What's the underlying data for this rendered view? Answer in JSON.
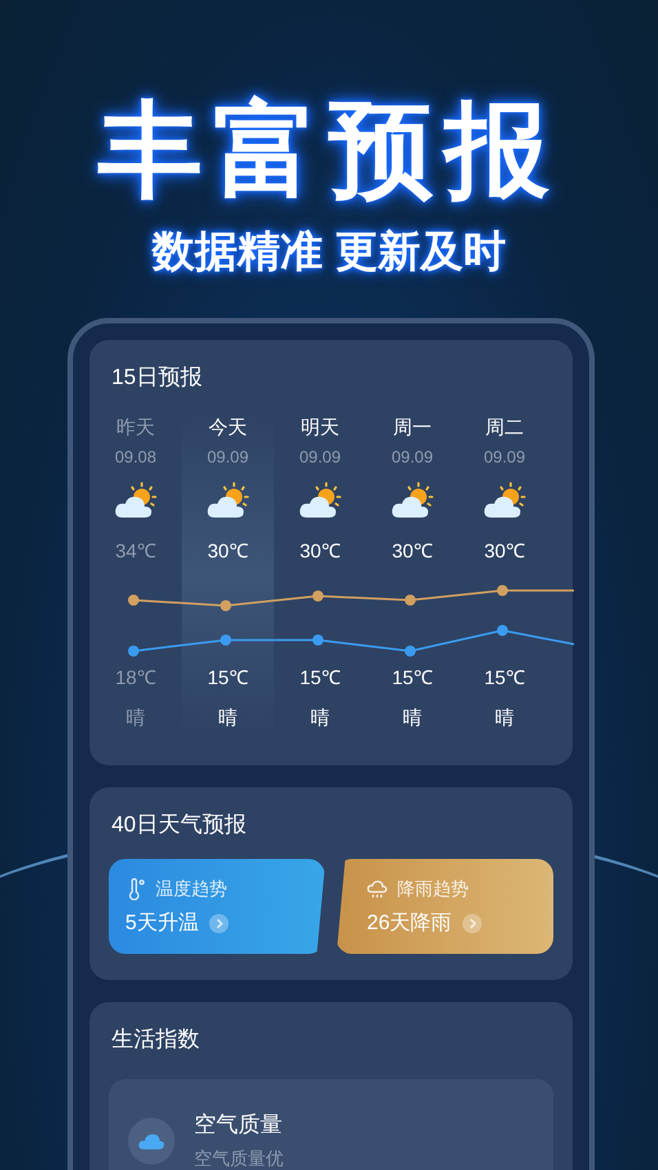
{
  "headline": "丰富预报",
  "subheadline": "数据精准 更新及时",
  "forecast_15": {
    "title": "15日预报",
    "days": [
      {
        "label": "昨天",
        "date": "09.08",
        "high": "34℃",
        "low": "18℃",
        "condition": "晴",
        "past": true,
        "selected": false
      },
      {
        "label": "今天",
        "date": "09.09",
        "high": "30℃",
        "low": "15℃",
        "condition": "晴",
        "past": false,
        "selected": true
      },
      {
        "label": "明天",
        "date": "09.09",
        "high": "30℃",
        "low": "15℃",
        "condition": "晴",
        "past": false,
        "selected": false
      },
      {
        "label": "周一",
        "date": "09.09",
        "high": "30℃",
        "low": "15℃",
        "condition": "晴",
        "past": false,
        "selected": false
      },
      {
        "label": "周二",
        "date": "09.09",
        "high": "30℃",
        "low": "15℃",
        "condition": "晴",
        "past": false,
        "selected": false
      }
    ]
  },
  "forecast_40": {
    "title": "40日天气预报",
    "tiles": [
      {
        "kind": "temperature",
        "label": "温度趋势",
        "value": "5天升温"
      },
      {
        "kind": "rain",
        "label": "降雨趋势",
        "value": "26天降雨"
      }
    ]
  },
  "life_index": {
    "title": "生活指数",
    "items": [
      {
        "title": "空气质量",
        "subtitle": "空气质量优"
      }
    ]
  }
}
